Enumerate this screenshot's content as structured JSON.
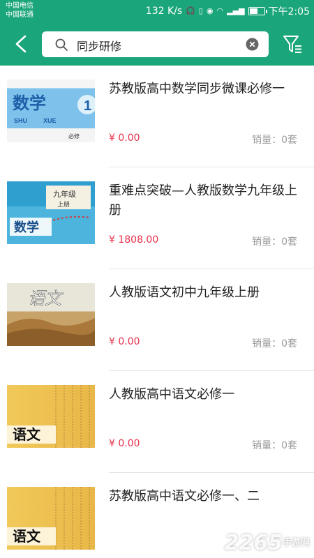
{
  "status": {
    "carrier1": "中国电信",
    "carrier2": "中国联通",
    "speed": "132 K/s",
    "time": "下午2:05",
    "battery_level": 0.6
  },
  "header": {
    "search_value": "同步研修"
  },
  "items": [
    {
      "title": "苏教版高中数学同步微课必修一",
      "price": "¥ 0.00",
      "sales": "销量：0套",
      "cover": "cover-math1"
    },
    {
      "title": "重难点突破—人教版数学九年级上册",
      "price": "¥ 1808.00",
      "sales": "销量：0套",
      "cover": "cover-math9"
    },
    {
      "title": "人教版语文初中九年级上册",
      "price": "¥ 0.00",
      "sales": "销量：0套",
      "cover": "cover-yuwen9"
    },
    {
      "title": "人教版高中语文必修一",
      "price": "¥ 0.00",
      "sales": "销量：0套",
      "cover": "cover-yuwenA"
    },
    {
      "title": "苏教版高中语文必修一、二",
      "price": "",
      "sales": "",
      "cover": "cover-yuwenA"
    }
  ],
  "covers": {
    "math1": {
      "big": "数学",
      "shu": "SHU",
      "xue": "XUE",
      "vol": "1",
      "bottom": "必修"
    },
    "math9": {
      "grade": "九年级",
      "vol": "上册",
      "big": "数学"
    },
    "yuwen9": {
      "big": "语文"
    },
    "yuwenA": {
      "big": "语文"
    }
  },
  "watermark": {
    "text": "2265",
    "site": "手游网"
  }
}
